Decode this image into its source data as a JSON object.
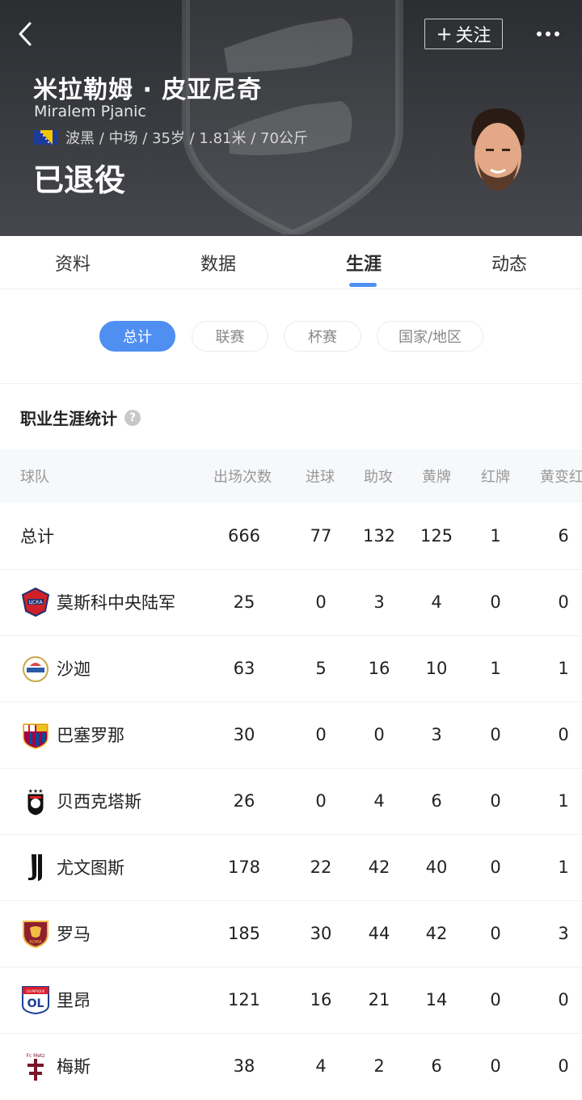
{
  "header": {
    "follow_label": "关注",
    "name_cn": "米拉勒姆 · 皮亚尼奇",
    "name_en": "Miralem Pjanic",
    "info": "波黑 / 中场 / 35岁 / 1.81米 / 70公斤",
    "status": "已退役"
  },
  "tabs": [
    "资料",
    "数据",
    "生涯",
    "动态"
  ],
  "active_tab": "生涯",
  "filters": [
    "总计",
    "联赛",
    "杯赛",
    "国家/地区"
  ],
  "active_filter": "总计",
  "section_title": "职业生涯统计",
  "table": {
    "headers": [
      "球队",
      "出场次数",
      "进球",
      "助攻",
      "黄牌",
      "红牌",
      "黄变红"
    ],
    "total": {
      "team": "总计",
      "apps": "666",
      "goals": "77",
      "assists": "132",
      "yellow": "125",
      "red": "1",
      "yellow_red": "6"
    },
    "rows": [
      {
        "team": "莫斯科中央陆军",
        "apps": "25",
        "goals": "0",
        "assists": "3",
        "yellow": "4",
        "red": "0",
        "yellow_red": "0"
      },
      {
        "team": "沙迦",
        "apps": "63",
        "goals": "5",
        "assists": "16",
        "yellow": "10",
        "red": "1",
        "yellow_red": "1"
      },
      {
        "team": "巴塞罗那",
        "apps": "30",
        "goals": "0",
        "assists": "0",
        "yellow": "3",
        "red": "0",
        "yellow_red": "0"
      },
      {
        "team": "贝西克塔斯",
        "apps": "26",
        "goals": "0",
        "assists": "4",
        "yellow": "6",
        "red": "0",
        "yellow_red": "1"
      },
      {
        "team": "尤文图斯",
        "apps": "178",
        "goals": "22",
        "assists": "42",
        "yellow": "40",
        "red": "0",
        "yellow_red": "1"
      },
      {
        "team": "罗马",
        "apps": "185",
        "goals": "30",
        "assists": "44",
        "yellow": "42",
        "red": "0",
        "yellow_red": "3"
      },
      {
        "team": "里昂",
        "apps": "121",
        "goals": "16",
        "assists": "21",
        "yellow": "14",
        "red": "0",
        "yellow_red": "0"
      },
      {
        "team": "梅斯",
        "apps": "38",
        "goals": "4",
        "assists": "2",
        "yellow": "6",
        "red": "0",
        "yellow_red": "0"
      }
    ]
  },
  "icons": {
    "back": "chevron-left-icon",
    "more": "more-dots-icon",
    "help": "question-icon",
    "flag": "bosnia-flag-icon"
  },
  "colors": {
    "accent": "#4f8ff2",
    "header_bg": "#36383d"
  }
}
